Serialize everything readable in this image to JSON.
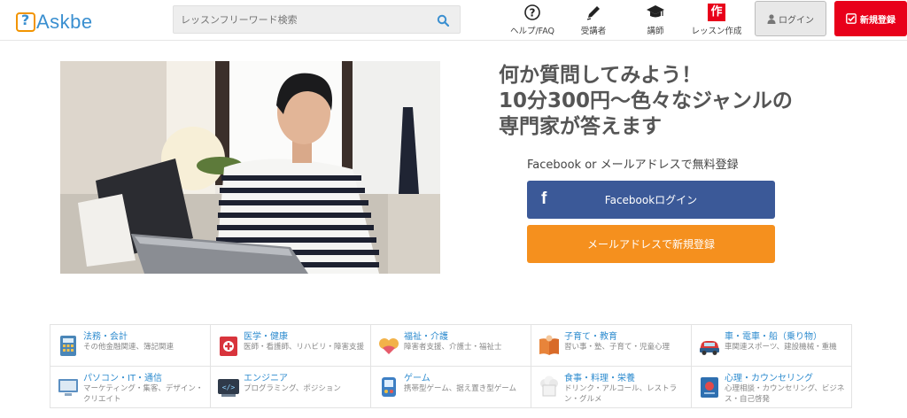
{
  "header": {
    "logo_text": "Askbe",
    "search_placeholder": "レッスンフリーワード検索",
    "nav": [
      {
        "label": "ヘルプ/FAQ",
        "icon": "help-icon"
      },
      {
        "label": "受講者",
        "icon": "pen-icon"
      },
      {
        "label": "講師",
        "icon": "graduation-cap-icon"
      },
      {
        "label": "レッスン作成",
        "icon": "create-lesson-icon",
        "badge": "作"
      }
    ],
    "login_label": "ログイン",
    "register_label": "新規登録"
  },
  "hero": {
    "title_line1": "何か質問してみよう！",
    "title_line2": "10分300円〜色々なジャンルの",
    "title_line3": "専門家が答えます",
    "signup_caption": "Facebook or メールアドレスで無料登録",
    "facebook_button": "Facebookログイン",
    "mail_button": "メールアドレスで新規登録"
  },
  "categories": [
    {
      "title": "法務・会計",
      "desc": "その他金融関連、簿記関連",
      "icon": "calculator-icon"
    },
    {
      "title": "医学・健康",
      "desc": "医師・看護師、リハビリ・障害支援",
      "icon": "medical-icon"
    },
    {
      "title": "福祉・介護",
      "desc": "障害者支援、介護士・福祉士",
      "icon": "care-icon"
    },
    {
      "title": "子育て・教育",
      "desc": "習い事・塾、子育て・児童心理",
      "icon": "book-icon"
    },
    {
      "title": "車・電車・船（乗り物）",
      "desc": "車関連スポーツ、建設機械・重機",
      "icon": "car-icon"
    },
    {
      "title": "パソコン・IT・通信",
      "desc": "マーケティング・集客、デザイン・クリエイト",
      "icon": "computer-icon"
    },
    {
      "title": "エンジニア",
      "desc": "プログラミング、ポジション",
      "icon": "code-icon"
    },
    {
      "title": "ゲーム",
      "desc": "携帯型ゲーム、据え置き型ゲーム",
      "icon": "game-icon"
    },
    {
      "title": "食事・料理・栄養",
      "desc": "ドリンク・アルコール、レストラン・グルメ",
      "icon": "chef-icon"
    },
    {
      "title": "心理・カウンセリング",
      "desc": "心理相談・カウンセリング、ビジネス・自己啓発",
      "icon": "psychology-icon"
    }
  ],
  "colors": {
    "brand_blue": "#3a8fd0",
    "brand_orange": "#f29400",
    "register_red": "#e8001a",
    "facebook_blue": "#3b5998",
    "mail_orange": "#f5901e",
    "category_title": "#2f8ccf"
  }
}
